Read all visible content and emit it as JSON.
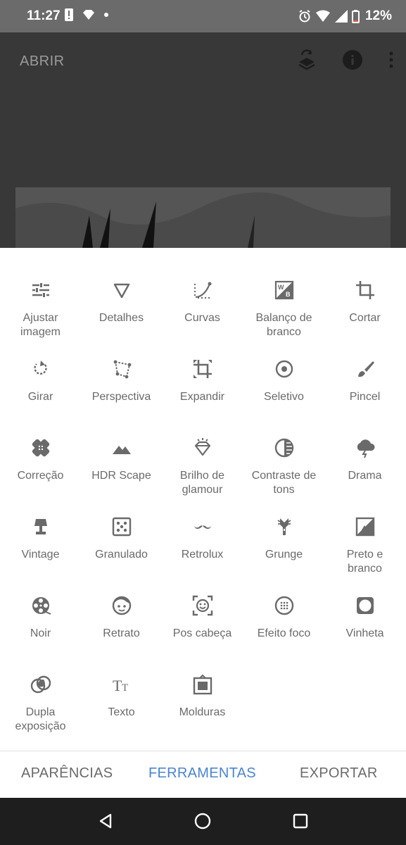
{
  "status": {
    "time": "11:27",
    "battery": "12%"
  },
  "appbar": {
    "open_label": "ABRIR"
  },
  "tools": [
    {
      "label": "Ajustar\nimagem",
      "icon": "sliders-icon"
    },
    {
      "label": "Detalhes",
      "icon": "triangle-down-icon"
    },
    {
      "label": "Curvas",
      "icon": "curves-icon"
    },
    {
      "label": "Balanço de\nbranco",
      "icon": "white-balance-icon"
    },
    {
      "label": "Cortar",
      "icon": "crop-icon"
    },
    {
      "label": "Girar",
      "icon": "rotate-icon"
    },
    {
      "label": "Perspectiva",
      "icon": "perspective-icon"
    },
    {
      "label": "Expandir",
      "icon": "expand-icon"
    },
    {
      "label": "Seletivo",
      "icon": "selective-icon"
    },
    {
      "label": "Pincel",
      "icon": "brush-icon"
    },
    {
      "label": "Correção",
      "icon": "bandage-icon"
    },
    {
      "label": "HDR Scape",
      "icon": "mountains-icon"
    },
    {
      "label": "Brilho de\nglamour",
      "icon": "diamond-icon"
    },
    {
      "label": "Contraste de\ntons",
      "icon": "tonal-contrast-icon"
    },
    {
      "label": "Drama",
      "icon": "storm-cloud-icon"
    },
    {
      "label": "Vintage",
      "icon": "lamp-icon"
    },
    {
      "label": "Granulado",
      "icon": "dice-icon"
    },
    {
      "label": "Retrolux",
      "icon": "mustache-icon"
    },
    {
      "label": "Grunge",
      "icon": "guitar-icon"
    },
    {
      "label": "Preto e\nbranco",
      "icon": "black-white-icon"
    },
    {
      "label": "Noir",
      "icon": "film-reel-icon"
    },
    {
      "label": "Retrato",
      "icon": "face-icon"
    },
    {
      "label": "Pos cabeça",
      "icon": "face-frame-icon"
    },
    {
      "label": "Efeito foco",
      "icon": "lens-blur-icon"
    },
    {
      "label": "Vinheta",
      "icon": "vignette-icon"
    },
    {
      "label": "Dupla\nexposição",
      "icon": "double-exposure-icon"
    },
    {
      "label": "Texto",
      "icon": "text-icon"
    },
    {
      "label": "Molduras",
      "icon": "frame-icon"
    }
  ],
  "tabs": {
    "looks": "APARÊNCIAS",
    "tools": "FERRAMENTAS",
    "export": "EXPORTAR"
  },
  "colors": {
    "accent": "#4a84d2",
    "icon": "#6a6a6a"
  }
}
